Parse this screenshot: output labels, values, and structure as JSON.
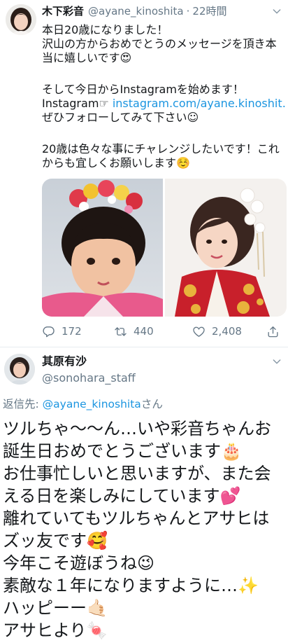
{
  "tweet": {
    "author_name": "木下彩音",
    "author_handle": "@ayane_kinoshita",
    "separator": "·",
    "time": "22時間",
    "body": {
      "p1": [
        "本日20歳になりました！",
        "沢山の方からおめでとうのメッセージを頂き本",
        "当に嬉しいです😍"
      ],
      "p2_line1": "そして今日からInstagramを始めます！",
      "p2_link_prefix": "Instagram☞ ",
      "p2_link": "instagram.com/ayane.kinoshit…",
      "p2_line3": "ぜひフォローしてみて下さい☺",
      "p3": [
        "20歳は色々な事にチャレンジしたいです！これ",
        "からも宜しくお願いします☺️"
      ]
    },
    "stats": {
      "replies": "172",
      "retweets": "440",
      "likes": "2,408"
    }
  },
  "reply": {
    "author_name": "其原有沙",
    "author_handle": "@sonohara_staff",
    "reply_to_label": "返信先: ",
    "reply_to_handle": "@ayane_kinoshita",
    "reply_to_suffix": "さん",
    "lines": [
      "ツルちゃ〜〜ん…いや彩音ちゃんお",
      "誕生日おめでとうございます🎂",
      "お仕事忙しいと思いますが、また会",
      "える日を楽しみにしています💕",
      "離れていてもツルちゃんとアサヒは",
      "ズッ友です🥰",
      "今年こそ遊ぼうね😉",
      "素敵な１年になりますように…✨",
      "ハッピーー🤙🏻",
      "アサヒより🍬"
    ]
  },
  "icons": {
    "menu": "chevron-down-icon",
    "reply": "comment-icon",
    "retweet": "retweet-icon",
    "like": "heart-icon",
    "share": "share-icon"
  },
  "colors": {
    "text": "#14171a",
    "secondary": "#657786",
    "link": "#1b95e0",
    "divider": "#e6ecf0"
  }
}
